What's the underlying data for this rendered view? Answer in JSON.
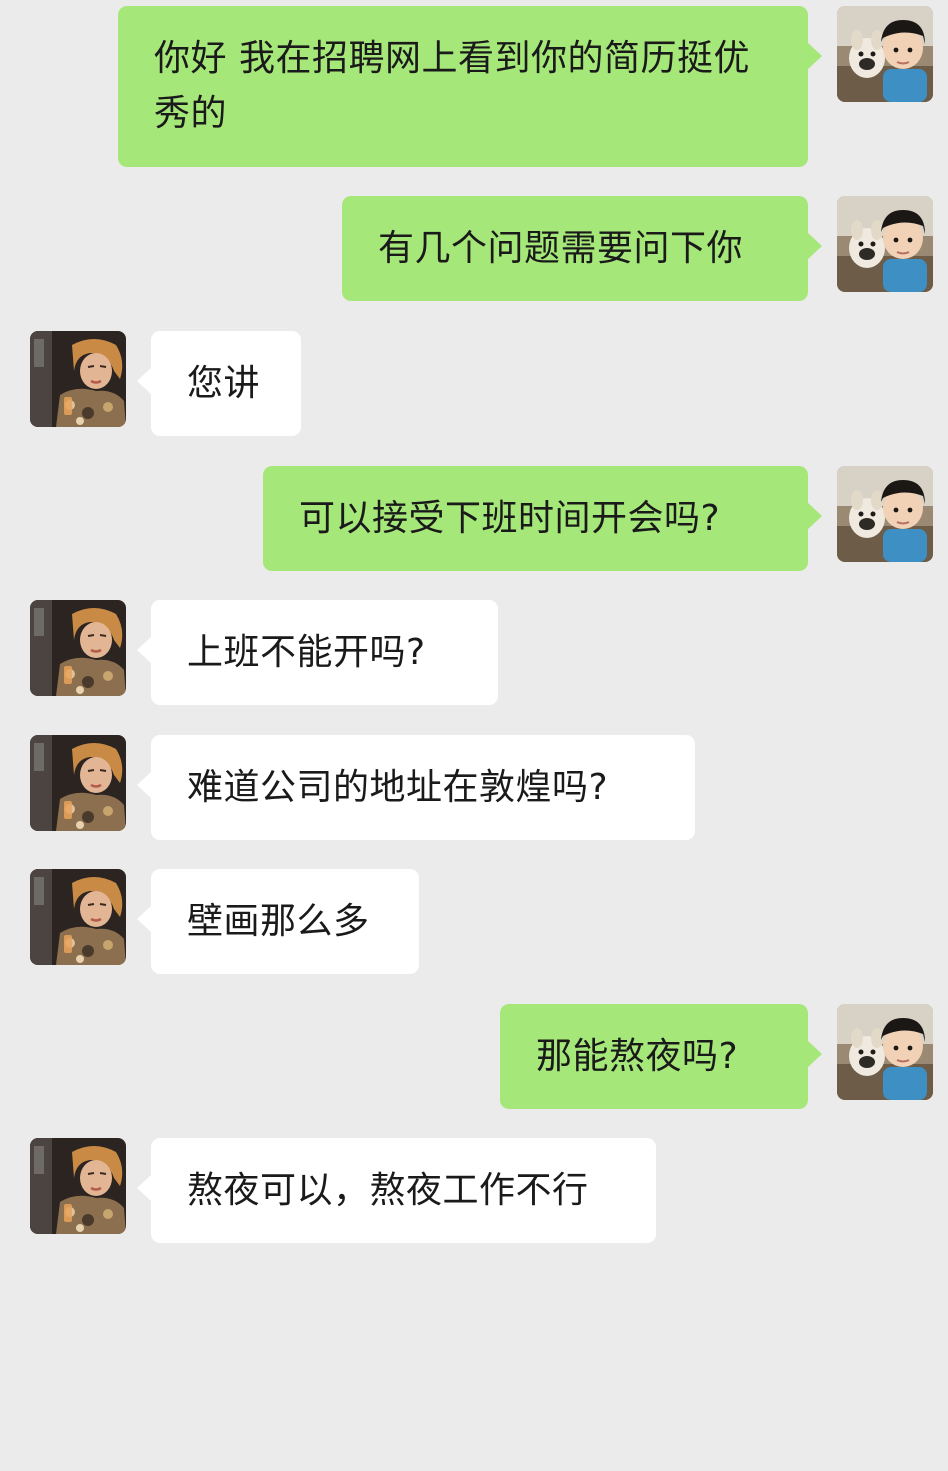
{
  "colors": {
    "background": "#ebebeb",
    "sent_bubble": "#a6e77a",
    "received_bubble": "#ffffff",
    "text": "#1a1a1a"
  },
  "avatars": {
    "me": "avatar-boy-with-dog-icon",
    "them": "avatar-woman-portrait-icon"
  },
  "messages": [
    {
      "sender": "me",
      "text": "你好 我在招聘网上看到你的简历挺优秀的"
    },
    {
      "sender": "me",
      "text": "有几个问题需要问下你"
    },
    {
      "sender": "them",
      "text": "您讲"
    },
    {
      "sender": "me",
      "text": "可以接受下班时间开会吗?"
    },
    {
      "sender": "them",
      "text": "上班不能开吗?"
    },
    {
      "sender": "them",
      "text": "难道公司的地址在敦煌吗?"
    },
    {
      "sender": "them",
      "text": "壁画那么多"
    },
    {
      "sender": "me",
      "text": "那能熬夜吗?"
    },
    {
      "sender": "them",
      "text": "熬夜可以，熬夜工作不行"
    }
  ]
}
